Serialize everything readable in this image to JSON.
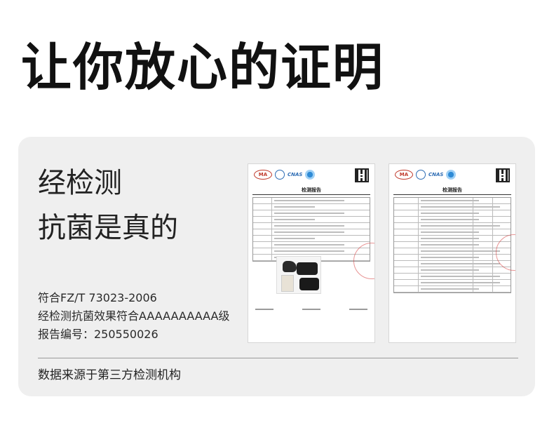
{
  "headline": "让你放心的证明",
  "lead": {
    "line1": "经检测",
    "line2": "抗菌是真的"
  },
  "info": {
    "standard": "符合FZ/T 73023-2006",
    "grade": "经检测抗菌效果符合AAAAAAAAAA级",
    "report_no": "报告编号：250550026"
  },
  "source": "数据来源于第三方检测机构",
  "reports": [
    {
      "title": "检测报告",
      "logo": "MA"
    },
    {
      "title": "检测报告",
      "logo": "MA"
    }
  ],
  "colors": {
    "card_bg": "#efefef",
    "stamp": "#d63c3c",
    "logo_blue": "#2e6db4"
  }
}
